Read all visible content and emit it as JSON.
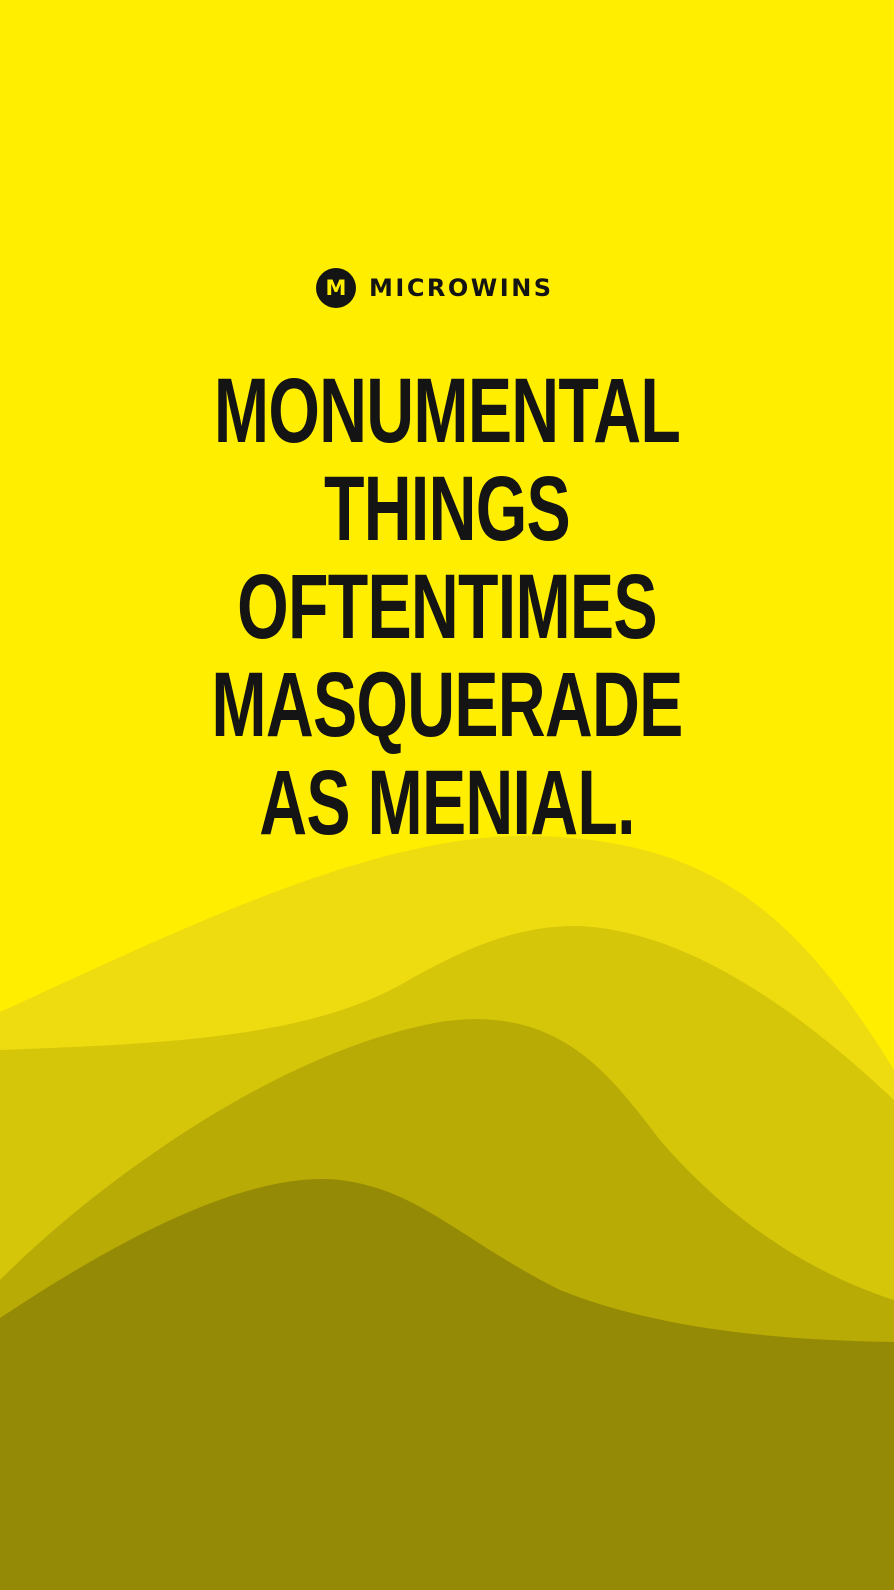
{
  "brand": {
    "logo_letter": "M",
    "name": "MICROWINS"
  },
  "headline": {
    "lines": [
      "MONUMENTAL",
      "THINGS",
      "OFTENTIMES",
      "MASQUERADE",
      "AS MENIAL."
    ]
  },
  "colors": {
    "background": "#FFEE00",
    "text": "#141414",
    "wave_1": "#EEDC10",
    "wave_2": "#D6C60A",
    "wave_3": "#B8AB05",
    "wave_4": "#958A05"
  }
}
